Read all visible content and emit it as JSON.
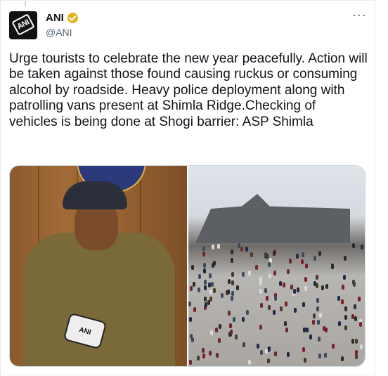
{
  "author": {
    "name": "ANI",
    "handle": "@ANI",
    "verified": true,
    "verified_color": "#e0b520",
    "avatar_text": "ANI"
  },
  "more_label": "···",
  "tweet": {
    "text": "Urge tourists to celebrate the new year peacefully. Action will be taken against those found causing ruckus or consuming alcohol by roadside. Heavy police deployment along with patrolling vans present at Shimla Ridge.Checking of vehicles is being done at Shogi barrier: ASP Shimla"
  },
  "media": {
    "left_image_mic_text": "ANI"
  }
}
